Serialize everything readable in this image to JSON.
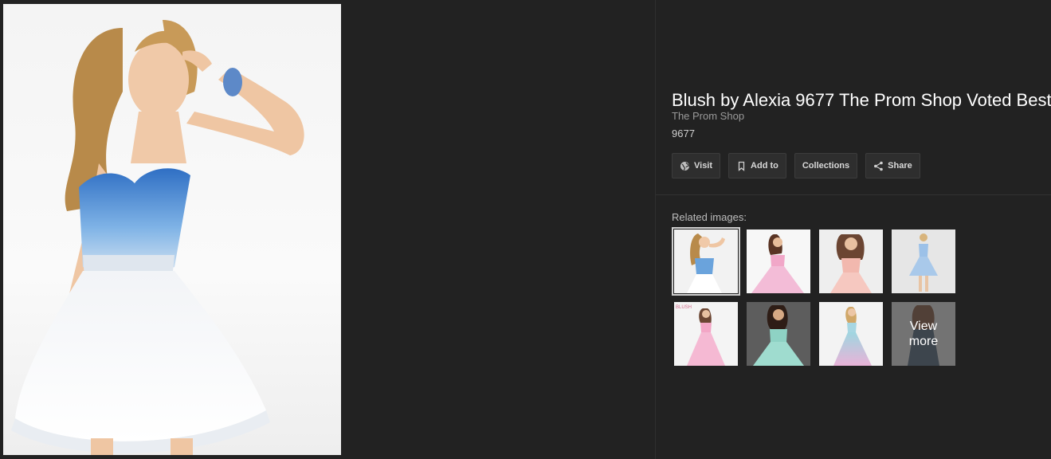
{
  "product": {
    "title": "Blush by Alexia 9677 The Prom Shop Voted Best",
    "source": "The Prom Shop",
    "description": "9677"
  },
  "actions": {
    "visit": "Visit",
    "add_to": "Add to",
    "collections": "Collections",
    "share": "Share"
  },
  "related": {
    "label": "Related images:",
    "view_more": "View\nmore",
    "thumb_watermark": "BLUSH"
  },
  "colors": {
    "background": "#222222",
    "title": "#ffffff",
    "button_bg": "#2e2e2e"
  }
}
